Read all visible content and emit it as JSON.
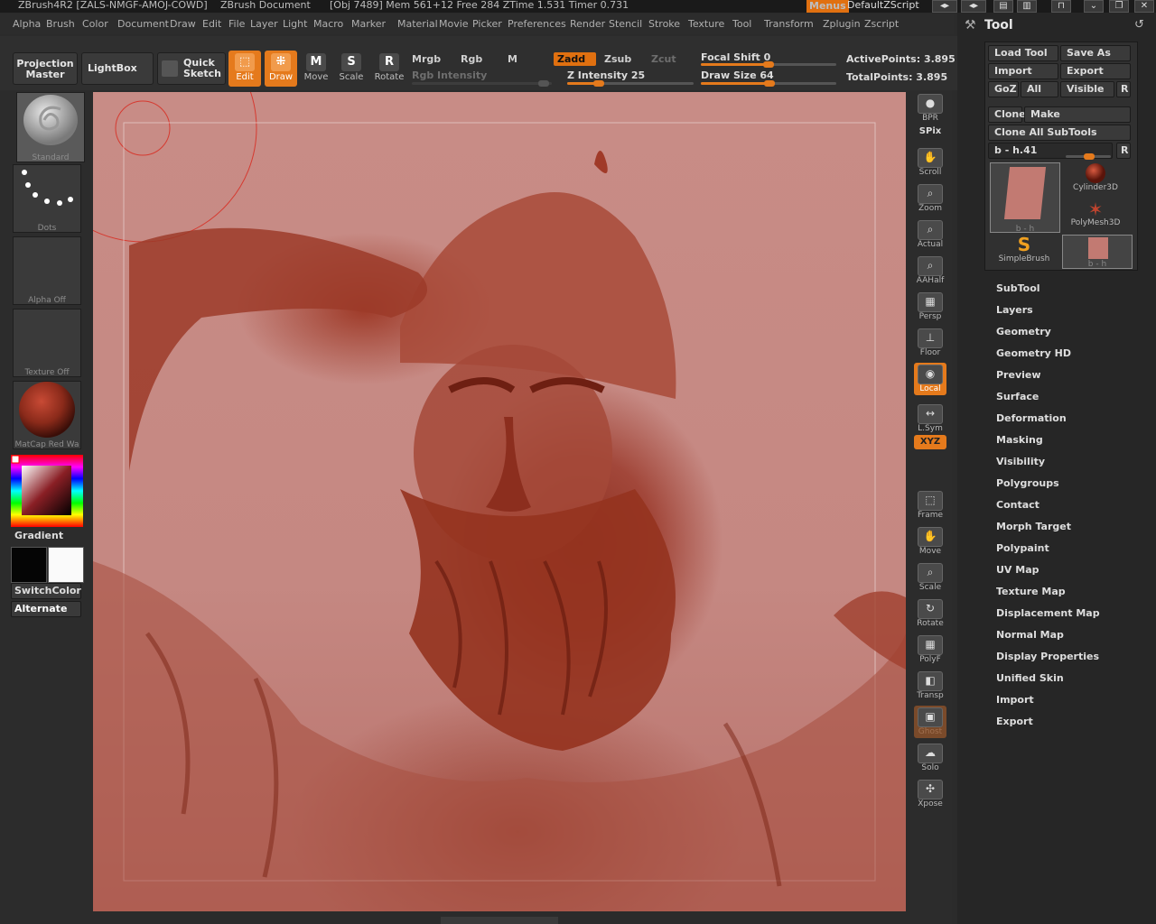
{
  "titlebar": {
    "app": "ZBrush4R2 [ZALS-NMGF-AMOJ-COWD]",
    "document": "ZBrush Document",
    "stats": "[Obj 7489] Mem 561+12 Free 284 ZTime 1.531 Timer 0.731",
    "menus_button": "Menus",
    "zscript": "DefaultZScript"
  },
  "menubar": [
    "Alpha",
    "Brush",
    "Color",
    "Document",
    "Draw",
    "Edit",
    "File",
    "Layer",
    "Light",
    "Macro",
    "Marker",
    "Material",
    "Movie",
    "Picker",
    "Preferences",
    "Render",
    "Stencil",
    "Stroke",
    "Texture",
    "Tool",
    "Transform",
    "Zplugin",
    "Zscript"
  ],
  "topshelf": {
    "projection_master": [
      "Projection",
      "Master"
    ],
    "lightbox": "LightBox",
    "quick_sketch": [
      "Quick",
      "Sketch"
    ],
    "edit": "Edit",
    "draw": "Draw",
    "move": "Move",
    "scale": "Scale",
    "rotate": "Rotate",
    "mrgb": "Mrgb",
    "rgb": "Rgb",
    "m": "M",
    "rgb_intensity": "Rgb Intensity",
    "zadd": "Zadd",
    "zsub": "Zsub",
    "zcut": "Zcut",
    "z_intensity": "Z Intensity 25",
    "focal_shift": "Focal Shift 0",
    "draw_size": "Draw Size 64",
    "active_points": "ActivePoints: 3.895",
    "total_points": "TotalPoints: 3.895",
    "z_intensity_value": 25,
    "draw_size_value": 64,
    "focal_shift_value": 0
  },
  "leftshelf": {
    "brush_caption": "Standard",
    "stroke_caption": "Dots",
    "alpha_caption": "Alpha Off",
    "texture_caption": "Texture Off",
    "material_caption": "MatCap Red Wa",
    "gradient": "Gradient",
    "switch_color": "SwitchColor",
    "alternate": "Alternate"
  },
  "rightshelf": [
    {
      "name": "bpr-button",
      "label": "BPR",
      "icon": "sphere-icon"
    },
    {
      "name": "spix-button",
      "label": "SPix",
      "icon": "slider-icon"
    },
    {
      "name": "scroll-button",
      "label": "Scroll",
      "icon": "hand-icon"
    },
    {
      "name": "zoom-button",
      "label": "Zoom",
      "icon": "magnifier-icon"
    },
    {
      "name": "actual-button",
      "label": "Actual",
      "icon": "magnifier-icon"
    },
    {
      "name": "aahalf-button",
      "label": "AAHalf",
      "icon": "magnifier-icon"
    },
    {
      "name": "persp-button",
      "label": "Persp",
      "icon": "grid-icon"
    },
    {
      "name": "floor-button",
      "label": "Floor",
      "icon": "floor-icon"
    },
    {
      "name": "local-button",
      "label": "Local",
      "icon": "local-icon"
    },
    {
      "name": "lsym-button",
      "label": "L.Sym",
      "icon": "arrows-icon"
    },
    {
      "name": "xyz-button",
      "label": "XYZ",
      "icon": "xyz-icon"
    },
    {
      "name": "frame-button",
      "label": "Frame",
      "icon": "frame-icon"
    },
    {
      "name": "move-view-button",
      "label": "Move",
      "icon": "hand-icon"
    },
    {
      "name": "scale-view-button",
      "label": "Scale",
      "icon": "magnifier-icon"
    },
    {
      "name": "rotate-view-button",
      "label": "Rotate",
      "icon": "rotate-icon"
    },
    {
      "name": "polyf-button",
      "label": "PolyF",
      "icon": "grid-icon"
    },
    {
      "name": "transp-button",
      "label": "Transp",
      "icon": "transp-icon"
    },
    {
      "name": "ghost-button",
      "label": "Ghost",
      "icon": "ghost-icon"
    },
    {
      "name": "solo-button",
      "label": "Solo",
      "icon": "solo-icon"
    },
    {
      "name": "xpose-button",
      "label": "Xpose",
      "icon": "xpose-icon"
    }
  ],
  "tool": {
    "title": "Tool",
    "load_tool": "Load Tool",
    "save_as": "Save As",
    "import": "Import",
    "export": "Export",
    "goz": "GoZ",
    "all": "All",
    "visible": "Visible",
    "r": "R",
    "clone": "Clone",
    "make_polymesh": "Make PolyMesh3D",
    "clone_all": "Clone All SubTools",
    "current": "b - h.41",
    "thumb_current": "b - h",
    "cylinder": "Cylinder3D",
    "polymesh": "PolyMesh3D",
    "simplebrush": "SimpleBrush",
    "thumb_small": "b - h",
    "subpalettes": [
      "SubTool",
      "Layers",
      "Geometry",
      "Geometry HD",
      "Preview",
      "Surface",
      "Deformation",
      "Masking",
      "Visibility",
      "Polygroups",
      "Contact",
      "Morph Target",
      "Polypaint",
      "UV Map",
      "Texture Map",
      "Displacement Map",
      "Normal Map",
      "Display Properties",
      "Unified Skin",
      "Import",
      "Export"
    ]
  },
  "colors": {
    "accent": "#e57a1c",
    "canvas_bg": "#c58882",
    "model": "#9e3a28"
  }
}
